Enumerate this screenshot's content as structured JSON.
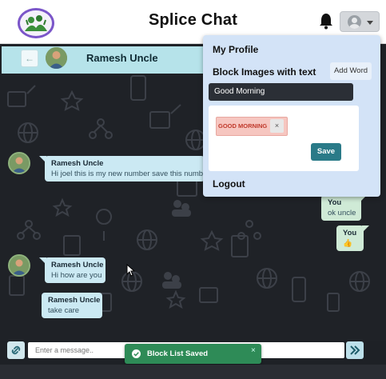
{
  "header": {
    "app_title": "Splice Chat",
    "icons": {
      "logo": "splice-logo",
      "bell": "bell-icon",
      "user": "user-avatar-icon",
      "caret": "chevron-down-icon"
    }
  },
  "contact": {
    "name": "Ramesh Uncle",
    "back_icon": "arrow-left-icon"
  },
  "messages": [
    {
      "sender": "Ramesh Uncle",
      "text": "Hi joel this is my new number save this number",
      "direction": "incoming"
    },
    {
      "sender": "You",
      "text": "ok uncle",
      "direction": "outgoing"
    },
    {
      "sender": "You",
      "text": "👍",
      "direction": "outgoing"
    },
    {
      "sender": "Ramesh Uncle",
      "text": "Hi how are you",
      "direction": "incoming"
    },
    {
      "sender": "Ramesh Uncle",
      "text": "take care",
      "direction": "incoming"
    }
  ],
  "menu": {
    "profile": "My Profile",
    "block_images_label": "Block Images with text",
    "add_word_button": "Add Word",
    "word_input_value": "Good Morning",
    "chips": [
      {
        "label": "GOOD MORNING",
        "remove": "×"
      }
    ],
    "save_button": "Save",
    "logout": "Logout"
  },
  "composer": {
    "placeholder": "Enter a message..",
    "attach_icon": "link-icon",
    "send_icon": "double-chevron-right-icon"
  },
  "toast": {
    "text": "Block List Saved",
    "close": "×",
    "icon": "check-circle-icon"
  },
  "colors": {
    "accent": "#2a7a88",
    "contact_bar": "#b6e3ea",
    "incoming_bubble": "#cbe9f3",
    "outgoing_bubble": "#cfead6",
    "toast": "#2e8b57",
    "menu_bg": "#d3e3f7",
    "chip_bg": "#f6c6c0"
  }
}
